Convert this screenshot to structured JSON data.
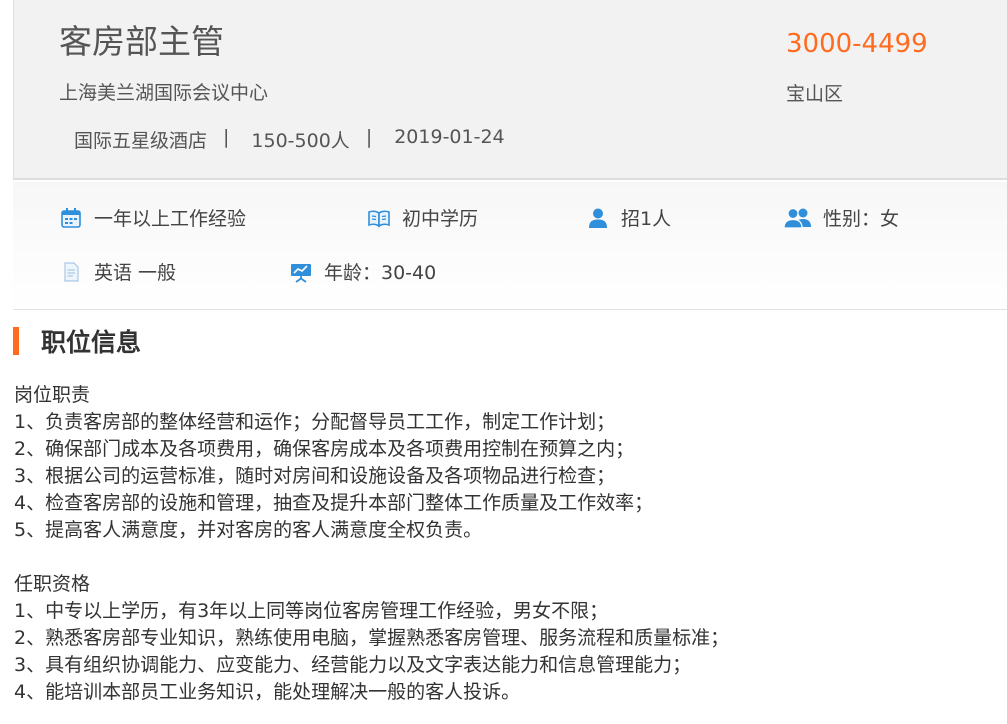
{
  "job": {
    "title": "客房部主管",
    "salary": "3000-4499",
    "company": "上海美兰湖国际会议中心",
    "district": "宝山区",
    "meta": {
      "type": "国际五星级酒店",
      "size": "150-500人",
      "date": "2019-01-24",
      "separator": "|"
    }
  },
  "requirements": [
    {
      "icon": "calendar-icon",
      "label": "一年以上工作经验"
    },
    {
      "icon": "book-icon",
      "label": "初中学历"
    },
    {
      "icon": "person-icon",
      "label": "招1人"
    },
    {
      "icon": "people-icon",
      "label": "性别：女"
    },
    {
      "icon": "document-icon",
      "label": "英语 一般"
    },
    {
      "icon": "presentation-icon",
      "label": "年龄：30-40"
    }
  ],
  "section": {
    "title": "职位信息"
  },
  "duties": {
    "heading": "岗位职责",
    "items": [
      "1、负责客房部的整体经营和运作；分配督导员工工作，制定工作计划；",
      "2、确保部门成本及各项费用，确保客房成本及各项费用控制在预算之内；",
      "3、根据公司的运营标准，随时对房间和设施设备及各项物品进行检查；",
      "4、检查客房部的设施和管理，抽查及提升本部门整体工作质量及工作效率；",
      "5、提高客人满意度，并对客房的客人满意度全权负责。"
    ]
  },
  "qualifications": {
    "heading": "任职资格",
    "items": [
      "1、中专以上学历，有3年以上同等岗位客房管理工作经验，男女不限；",
      "2、熟悉客房部专业知识，熟练使用电脑，掌握熟悉客房管理、服务流程和质量标准；",
      "3、具有组织协调能力、应变能力、经营能力以及文字表达能力和信息管理能力；",
      "4、能培训本部员工业务知识，能处理解决一般的客人投诉。"
    ]
  },
  "colors": {
    "accent": "#ff6b1f",
    "icon_blue": "#2f8fdb"
  }
}
